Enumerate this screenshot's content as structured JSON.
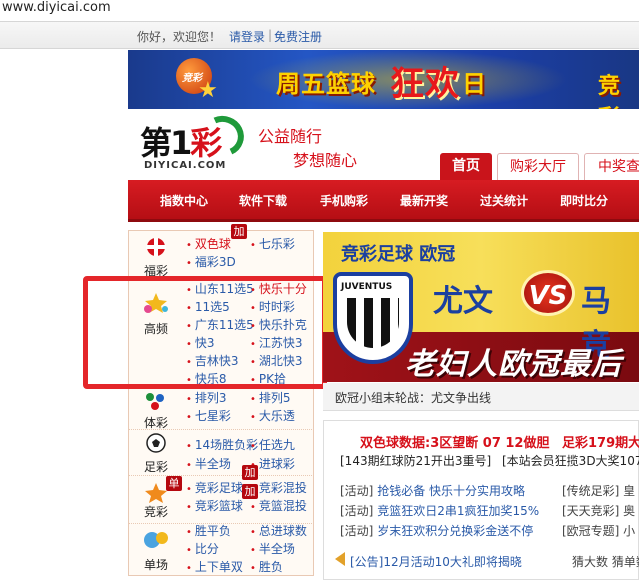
{
  "browser": {
    "url": "www.diyicai.com"
  },
  "topbar": {
    "greeting": "你好，欢迎您！",
    "login": "请登录",
    "sep": "|",
    "register": "免费注册"
  },
  "banner": {
    "part1": "周五篮球",
    "part2": "狂欢",
    "part3": "日",
    "part4": "竞彩",
    "ball_text": "竞彩"
  },
  "logo": {
    "text_a": "第1",
    "text_b": "彩",
    "domain": "DIYICAI.COM"
  },
  "slogan": {
    "line1": "公益随行",
    "line2": "梦想随心"
  },
  "tabs": [
    {
      "label": "首页",
      "active": true
    },
    {
      "label": "购彩大厅"
    },
    {
      "label": "中奖查"
    }
  ],
  "nav": [
    "指数中心",
    "软件下载",
    "手机购彩",
    "最新开奖",
    "过关统计",
    "即时比分"
  ],
  "categories": [
    {
      "label": "福彩",
      "icon": "fucai-icon",
      "games": [
        "双色球",
        "七乐彩",
        "福彩3D"
      ],
      "badge": "加"
    },
    {
      "label": "高频",
      "icon": "gaopin-star-icon",
      "games": [
        "山东11选5",
        "快乐十分",
        "11选5",
        "时时彩",
        "广东11选5",
        "快乐扑克",
        "快3",
        "江苏快3",
        "吉林快3",
        "湖北快3",
        "快乐8",
        "PK拾"
      ]
    },
    {
      "label": "体彩",
      "icon": "ticai-icon",
      "games": [
        "排列3",
        "排列5",
        "七星彩",
        "大乐透"
      ]
    },
    {
      "label": "足彩",
      "icon": "football-icon",
      "games": [
        "14场胜负彩",
        "任选九",
        "半全场",
        "进球彩"
      ]
    },
    {
      "label": "竞彩",
      "icon": "jingcai-icon",
      "games": [
        "竞彩足球",
        "竞彩混投",
        "竞彩篮球",
        "竞篮混投"
      ],
      "badges": [
        "单",
        "加",
        "加"
      ]
    },
    {
      "label": "单场",
      "icon": "danchang-icon",
      "games": [
        "胜平负",
        "总进球数",
        "比分",
        "半全场",
        "上下单双",
        "胜负"
      ]
    }
  ],
  "promo": {
    "headline": "竞彩足球  欧冠",
    "team1": "尤文",
    "vs": "VS",
    "team2": "马竞",
    "tagline": "老妇人欧冠最后",
    "club_badge": "JUVENTUS",
    "caption": "欧冠小组末轮战：尤文争出线"
  },
  "info": {
    "stat1": "双色球数据:3区望断 07 12做胆",
    "stat2": "足彩179期大",
    "sub1": "[143期红球防21开出3重号]",
    "sub2": "[本站会员狂揽3D大奖107",
    "activities": [
      {
        "tag": "[活动]",
        "text": "抢钱必备 快乐十分实用攻略"
      },
      {
        "tag": "[活动]",
        "text": "竞篮狂欢日2串1疯狂加奖15%"
      },
      {
        "tag": "[活动]",
        "text": "岁末狂欢积分兑换彩金送不停"
      }
    ],
    "right_links": [
      "[传统足彩] 皇",
      "[天天竞彩] 奥",
      "[欧冠专题] 小"
    ],
    "notice": "[公告]12月活动10大礼即将揭晓",
    "notice_right": "猜大数 猜单数"
  },
  "colors": {
    "brand_red": "#c9141b",
    "link_blue": "#2a5aa8",
    "highlight": "#e4262a"
  }
}
